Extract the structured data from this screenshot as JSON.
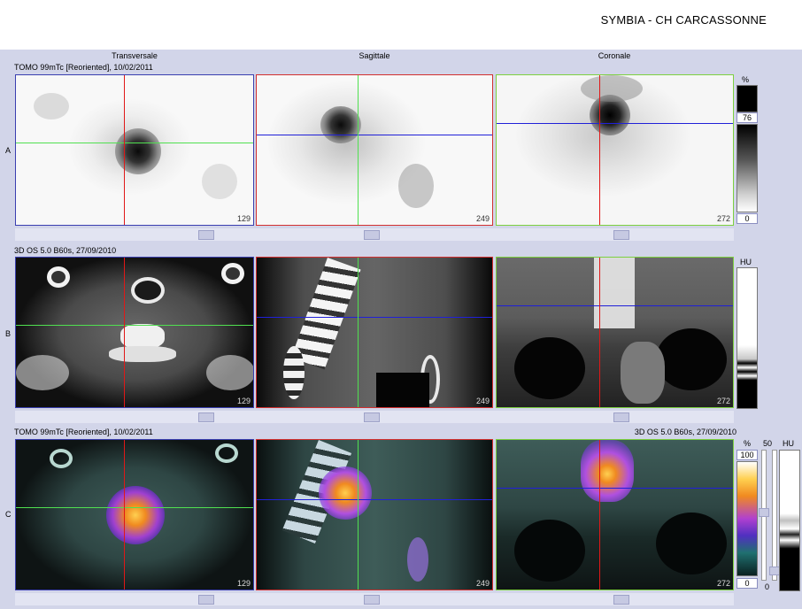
{
  "header": {
    "title": "SYMBIA - CH CARCASSONNE"
  },
  "columns": [
    "Transversale",
    "Sagittale",
    "Coronale"
  ],
  "rows": [
    {
      "label": "A",
      "info_left": "TOMO 99mTc [Reoriented], 10/02/2011",
      "info_right": ""
    },
    {
      "label": "B",
      "info_left": "3D  OS  5.0  B60s, 27/09/2010",
      "info_right": ""
    },
    {
      "label": "C",
      "info_left": "TOMO 99mTc [Reoriented], 10/02/2011",
      "info_right": "3D  OS  5.0  B60s, 27/09/2010"
    }
  ],
  "slices": {
    "transversale": "129",
    "sagittale": "249",
    "coronale": "272"
  },
  "colorbars": {
    "a": {
      "unit": "%",
      "window": "76",
      "min": "0"
    },
    "b": {
      "unit": "HU"
    },
    "c": {
      "unit": "%",
      "max": "100",
      "min": "0"
    },
    "c2": {
      "unit": "HU",
      "level": "50",
      "min": "0"
    }
  },
  "colors": {
    "panel_bg": "#d2d5e9",
    "border_transversale": "#3a3fb0",
    "border_sagittale": "#d23030",
    "border_coronale": "#7dd040"
  }
}
